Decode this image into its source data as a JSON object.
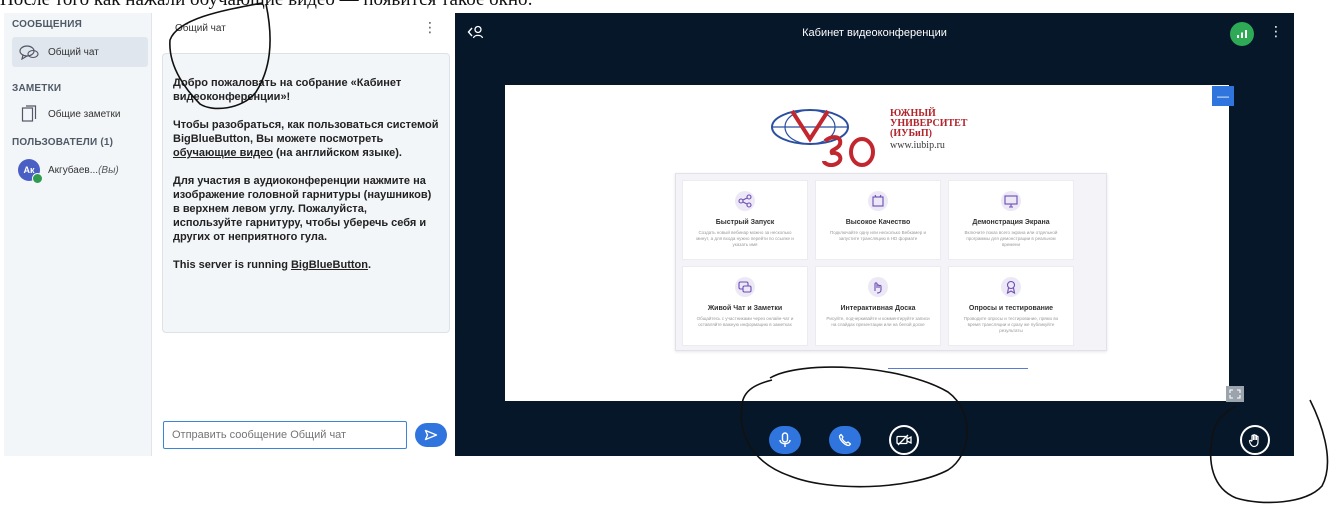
{
  "doc_caption": "После того как нажали обучающие видео — появится такое окно:",
  "sidebar": {
    "messages_title": "СООБЩЕНИЯ",
    "public_chat": "Общий чат",
    "notes_title": "ЗАМЕТКИ",
    "shared_notes": "Общие заметки",
    "users_title": "ПОЛЬЗОВАТЕЛИ (1)",
    "user_initials": "Ак",
    "user_name": "Акгубаев...",
    "user_you": "(Вы)"
  },
  "chat": {
    "header_title": "Общий чат",
    "welcome_p1_pre": "Добро пожаловать на собрание «",
    "welcome_p1_room": "Кабинет видеоконференции",
    "welcome_p1_post": "»!",
    "welcome_p2_pre": "Чтобы разобраться, как пользоваться системой BigBlueButton, Вы можете посмотреть ",
    "welcome_p2_link": "обучающие видео",
    "welcome_p2_post": " (на английском языке).",
    "welcome_p3_pre": "Для участия в аудиоконференции нажмите на изображение головной гарнитуры (наушников) в верхнем левом углу. ",
    "welcome_p3_bold": "Пожалуйста, используйте гарнитуру, чтобы уберечь себя и других от неприятного гула.",
    "welcome_p4_pre": "This server is running ",
    "welcome_p4_link": "BigBlueButton",
    "welcome_p4_post": ".",
    "input_placeholder": "Отправить сообщение Общий чат"
  },
  "conference": {
    "title": "Кабинет видеоконференции"
  },
  "slide": {
    "logo_line1": "ЮЖНЫЙ",
    "logo_line2": "УНИВЕРСИТЕТ",
    "logo_line3": "(ИУБиП)",
    "logo_url": "www.iubip.ru",
    "features": [
      {
        "title": "Быстрый Запуск",
        "desc": "Создать новый вебинар можно за несколько минут, а для входа нужно перейти по ссылке и указать имя"
      },
      {
        "title": "Высокое Качество",
        "desc": "Подключайте одну или несколько Вебкамер и запустите трансляцию в HD формате"
      },
      {
        "title": "Демонстрация Экрана",
        "desc": "Включите показ всего экрана или отдельной программы для демонстрации в реальном времени"
      },
      {
        "title": "Живой Чат и Заметки",
        "desc": "Общайтесь с участниками через онлайн-чат и оставляйте важную информацию в заметках"
      },
      {
        "title": "Интерактивная Доска",
        "desc": "Рисуйте, подчеркивайте и комментируйте записи на слайдах презентации или на белой доске"
      },
      {
        "title": "Опросы и тестирование",
        "desc": "Проводите опросы и тестирование, прямо во время трансляции и сразу же публикуйте результаты"
      }
    ]
  },
  "colors": {
    "accent": "#2f75dd",
    "conference_bg": "#06172a",
    "network_ok": "#2eaa56",
    "logo_red": "#b1242a"
  },
  "icons": {
    "public_chat": "chat-bubbles-icon",
    "shared_notes": "notes-icon",
    "users_toggle": "user-icon",
    "network": "signal-bars-icon",
    "mic": "microphone-icon",
    "phone": "phone-icon",
    "camera_off": "video-off-icon",
    "raise_hand": "hand-icon",
    "send": "send-arrow-icon",
    "fullscreen": "expand-icon"
  }
}
